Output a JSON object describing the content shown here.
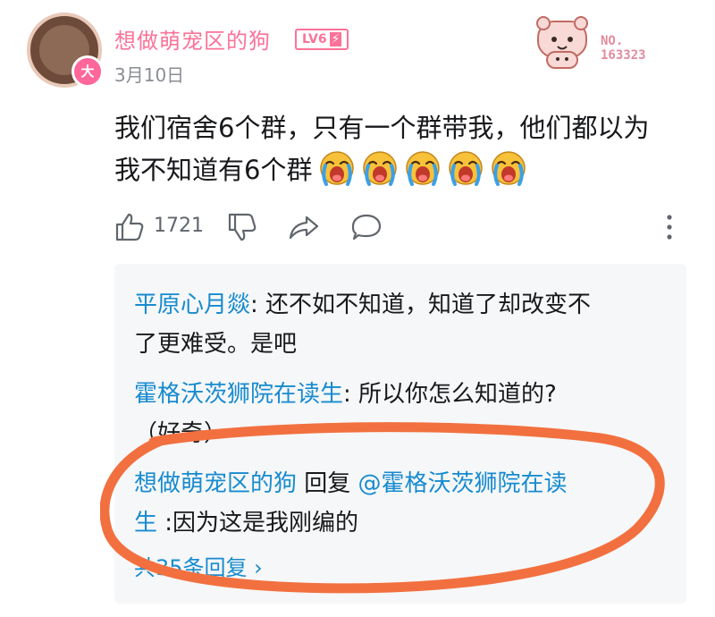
{
  "post": {
    "username": "想做萌宠区的狗",
    "level": "LV6",
    "date": "3月10日",
    "avatar_badge": "大",
    "fan_badge_label": "NO.",
    "fan_badge_number": "163323",
    "content_line1": "我们宿舍6个群，只有一个群带我，他们都以为",
    "content_line2": "我不知道有6个群",
    "emoji_count": 5,
    "like_count": "1721"
  },
  "replies": [
    {
      "name": "平原心月燚",
      "sep": ": ",
      "text_line1": "还不如不知道，知道了却改变不",
      "text_line2": "了更难受。是吧"
    },
    {
      "name": "霍格沃茨狮院在读生",
      "sep": ": ",
      "text_line1": "所以你怎么知道的?",
      "text_line2": "（好奇）"
    },
    {
      "name": "想做萌宠区的狗",
      "reply_word": " 回复 ",
      "mention": "@霍格沃茨狮院在读",
      "mention_tail": "生",
      "sep": " :",
      "text": "因为这是我刚编的"
    }
  ],
  "replies_footer": "共35条回复 ",
  "colors": {
    "accent_pink": "#fb7299",
    "link_blue": "#178bcf",
    "annotation_orange": "#f2703f",
    "reply_bg": "#f6f7f8"
  },
  "icons": [
    "thumb-up-icon",
    "thumb-down-icon",
    "share-icon",
    "comment-icon",
    "more-vertical-icon",
    "crying-emoji-icon",
    "chevron-right-icon",
    "bolt-icon"
  ]
}
